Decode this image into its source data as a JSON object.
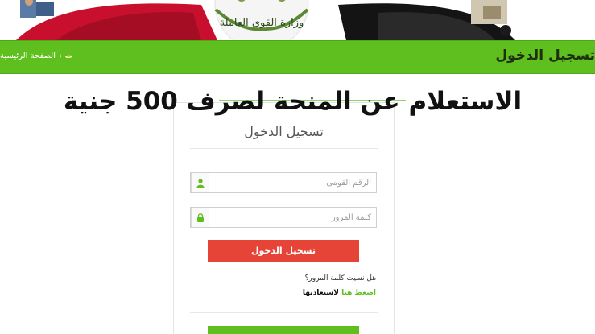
{
  "header": {
    "title": "تسجيل الدخول",
    "breadcrumb": {
      "home": "الصفحة الرئيسية",
      "separator": "›",
      "current": "ت"
    }
  },
  "banner": {
    "logo_text": "وزارة القوى العاملة",
    "colors": [
      "#c8102e",
      "#ffffff",
      "#111111"
    ]
  },
  "headline": {
    "text": "الاستعلام عن المنحة لصرف 500 جنية"
  },
  "login": {
    "title": "تسجيل الدخول",
    "national_id_placeholder": "الرقم القومى",
    "password_placeholder": "كلمة المرور",
    "national_id_value": "",
    "password_value": "",
    "submit_label": "تسجيل الدخول",
    "forgot_question": "هل نسيت كلمة المرور؟",
    "recover_link": "اضغط هنا",
    "recover_suffix": "لاستعادتها"
  },
  "colors": {
    "accent_green": "#5fbf1e",
    "login_red": "#e64437"
  }
}
